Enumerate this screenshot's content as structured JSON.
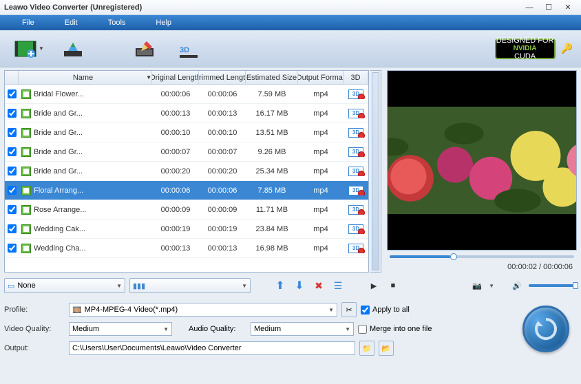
{
  "titlebar": {
    "title": "Leawo Video Converter (Unregistered)"
  },
  "menubar": {
    "file": "File",
    "edit": "Edit",
    "tools": "Tools",
    "help": "Help"
  },
  "columns": {
    "name": "Name",
    "orig": "Original Length",
    "trim": "Trimmed Length",
    "size": "Estimated Size",
    "fmt": "Output Format",
    "threeD": "3D"
  },
  "rows": [
    {
      "name": "Bridal Flower...",
      "orig": "00:00:06",
      "trim": "00:00:06",
      "size": "7.59 MB",
      "fmt": "mp4"
    },
    {
      "name": "Bride and Gr...",
      "orig": "00:00:13",
      "trim": "00:00:13",
      "size": "16.17 MB",
      "fmt": "mp4"
    },
    {
      "name": "Bride and Gr...",
      "orig": "00:00:10",
      "trim": "00:00:10",
      "size": "13.51 MB",
      "fmt": "mp4"
    },
    {
      "name": "Bride and Gr...",
      "orig": "00:00:07",
      "trim": "00:00:07",
      "size": "9.26 MB",
      "fmt": "mp4"
    },
    {
      "name": "Bride and Gr...",
      "orig": "00:00:20",
      "trim": "00:00:20",
      "size": "25.34 MB",
      "fmt": "mp4"
    },
    {
      "name": "Floral Arrang...",
      "orig": "00:00:06",
      "trim": "00:00:06",
      "size": "7.85 MB",
      "fmt": "mp4",
      "selected": true
    },
    {
      "name": "Rose Arrange...",
      "orig": "00:00:09",
      "trim": "00:00:09",
      "size": "11.71 MB",
      "fmt": "mp4"
    },
    {
      "name": "Wedding Cak...",
      "orig": "00:00:19",
      "trim": "00:00:19",
      "size": "23.84 MB",
      "fmt": "mp4"
    },
    {
      "name": "Wedding Cha...",
      "orig": "00:00:13",
      "trim": "00:00:13",
      "size": "16.98 MB",
      "fmt": "mp4"
    }
  ],
  "preview": {
    "current": "00:00:02",
    "duration": "00:00:06",
    "sep": " / "
  },
  "subtitle": {
    "value": "None"
  },
  "profile": {
    "label": "Profile:",
    "value": "MP4-MPEG-4 Video(*.mp4)",
    "apply": "Apply to all"
  },
  "vq": {
    "label": "Video Quality:",
    "value": "Medium"
  },
  "aq": {
    "label": "Audio Quality:",
    "value": "Medium"
  },
  "merge": "Merge into one file",
  "output": {
    "label": "Output:",
    "value": "C:\\Users\\User\\Documents\\Leawo\\Video Converter"
  },
  "nvidia": {
    "top": "DESIGNED FOR",
    "mid": "NVIDIA",
    "bot": "CUDA"
  }
}
